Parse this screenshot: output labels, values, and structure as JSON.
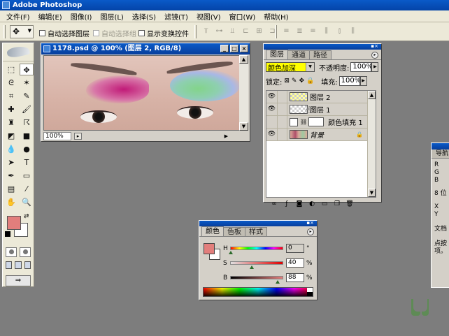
{
  "app": {
    "title": "Adobe Photoshop",
    "icon": "photoshop-icon"
  },
  "menu": [
    "文件(F)",
    "编辑(E)",
    "图像(I)",
    "图层(L)",
    "选择(S)",
    "滤镜(T)",
    "视图(V)",
    "窗口(W)",
    "帮助(H)"
  ],
  "options": {
    "auto_select_layer": "自动选择图层",
    "auto_select_group": "自动选择组",
    "show_transform": "显示变换控件"
  },
  "document": {
    "title": "1178.psd @ 100% (图层 2, RGB/8)",
    "zoom": "100%"
  },
  "layers_panel": {
    "tabs": [
      "图层",
      "通道",
      "路径"
    ],
    "blend_mode": "颜色加深",
    "opacity_label": "不透明度:",
    "opacity_value": "100%",
    "lock_label": "锁定:",
    "fill_label": "填充:",
    "fill_value": "100%",
    "layers": [
      {
        "name": "图层 2",
        "selected": true
      },
      {
        "name": "图层 1",
        "selected": false
      },
      {
        "name": "颜色填充 1",
        "selected": false
      },
      {
        "name": "背景",
        "selected": false
      }
    ]
  },
  "color_panel": {
    "tabs": [
      "颜色",
      "色板",
      "样式"
    ],
    "channels": [
      {
        "label": "H",
        "value": "0",
        "unit": "°"
      },
      {
        "label": "S",
        "value": "40",
        "unit": "%"
      },
      {
        "label": "B",
        "value": "88",
        "unit": "%"
      }
    ],
    "foreground": "#e27e7c"
  },
  "navigator": {
    "tab": "导航",
    "lines": [
      "R",
      "G",
      "B",
      "8 位",
      "X",
      "Y",
      "文档",
      "点按",
      "项。"
    ]
  },
  "colors": {
    "titlebar": "#0a5ac8",
    "selected_layer": "#ffff00",
    "workspace": "#7d7d7d"
  }
}
